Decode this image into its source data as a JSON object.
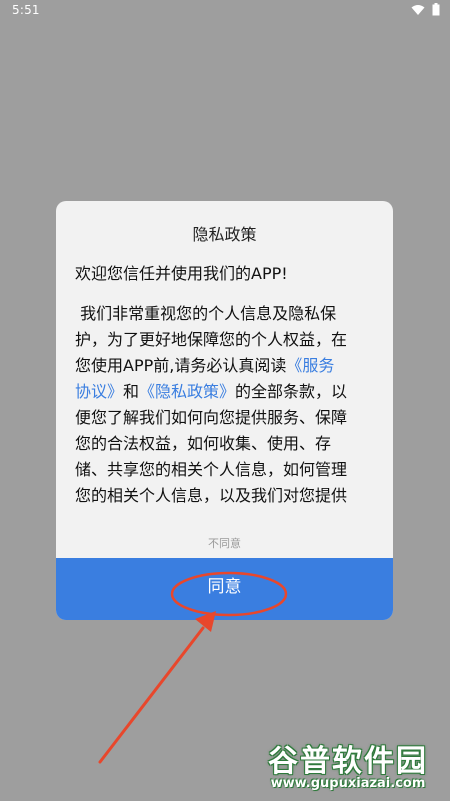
{
  "status_bar": {
    "time": "5:51",
    "icons": [
      "wifi-icon",
      "battery-icon"
    ]
  },
  "dialog": {
    "title": "隐私政策",
    "greeting": "欢迎您信任并使用我们的APP!",
    "body_lines": [
      "我们非常重视您的个人信息及隐私保",
      "护，为了更好地保障您的个人权益，在",
      "您使用APP前,请务必认真阅读"
    ],
    "link_service_1": "《服务",
    "link_service_2": "协议》",
    "and": "和",
    "link_privacy": "《隐私政策》",
    "after_links": "的全部条款，以",
    "body_lines_2": [
      "便您了解我们如何向您提供服务、保障",
      "您的合法权益，如何收集、使用、存",
      "储、共享您的相关个人信息，如何管理",
      "您的相关个人信息，以及我们对您提供"
    ],
    "disagree_label": "不同意",
    "agree_label": "同意"
  },
  "watermark": {
    "main": "谷普软件园",
    "sub": "www.gupuxiazai.com"
  },
  "colors": {
    "backdrop": "#9e9e9e",
    "dialog_bg": "#f2f2f2",
    "accent": "#3a7ee0",
    "annotation": "#e8472c"
  }
}
